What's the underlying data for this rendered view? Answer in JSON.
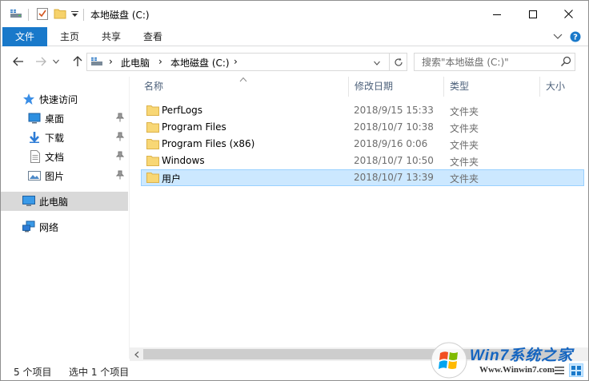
{
  "window": {
    "title": "本地磁盘 (C:)",
    "accent": "#1979ca"
  },
  "ribbon": {
    "tabs": [
      {
        "label": "文件",
        "active": true
      },
      {
        "label": "主页"
      },
      {
        "label": "共享"
      },
      {
        "label": "查看"
      }
    ]
  },
  "address": {
    "breadcrumbs": [
      "此电脑",
      "本地磁盘 (C:)"
    ]
  },
  "search": {
    "placeholder": "搜索\"本地磁盘 (C:)\""
  },
  "sidebar": {
    "quick_access": "快速访问",
    "pinned": [
      {
        "label": "桌面",
        "icon": "desktop-icon"
      },
      {
        "label": "下载",
        "icon": "download-icon"
      },
      {
        "label": "文档",
        "icon": "document-icon"
      },
      {
        "label": "图片",
        "icon": "picture-icon"
      }
    ],
    "this_pc": "此电脑",
    "network": "网络"
  },
  "columns": [
    "名称",
    "修改日期",
    "类型",
    "大小"
  ],
  "files": [
    {
      "name": "PerfLogs",
      "date": "2018/9/15 15:33",
      "type": "文件夹",
      "selected": false
    },
    {
      "name": "Program Files",
      "date": "2018/10/7 10:38",
      "type": "文件夹",
      "selected": false
    },
    {
      "name": "Program Files (x86)",
      "date": "2018/9/16 0:06",
      "type": "文件夹",
      "selected": false
    },
    {
      "name": "Windows",
      "date": "2018/10/7 10:50",
      "type": "文件夹",
      "selected": false
    },
    {
      "name": "用户",
      "date": "2018/10/7 13:39",
      "type": "文件夹",
      "selected": true
    }
  ],
  "status": {
    "count": "5 个项目",
    "selection": "选中 1 个项目"
  },
  "watermark": {
    "brand": "Win7系统之家",
    "url": "Www.Winwin7.com"
  }
}
